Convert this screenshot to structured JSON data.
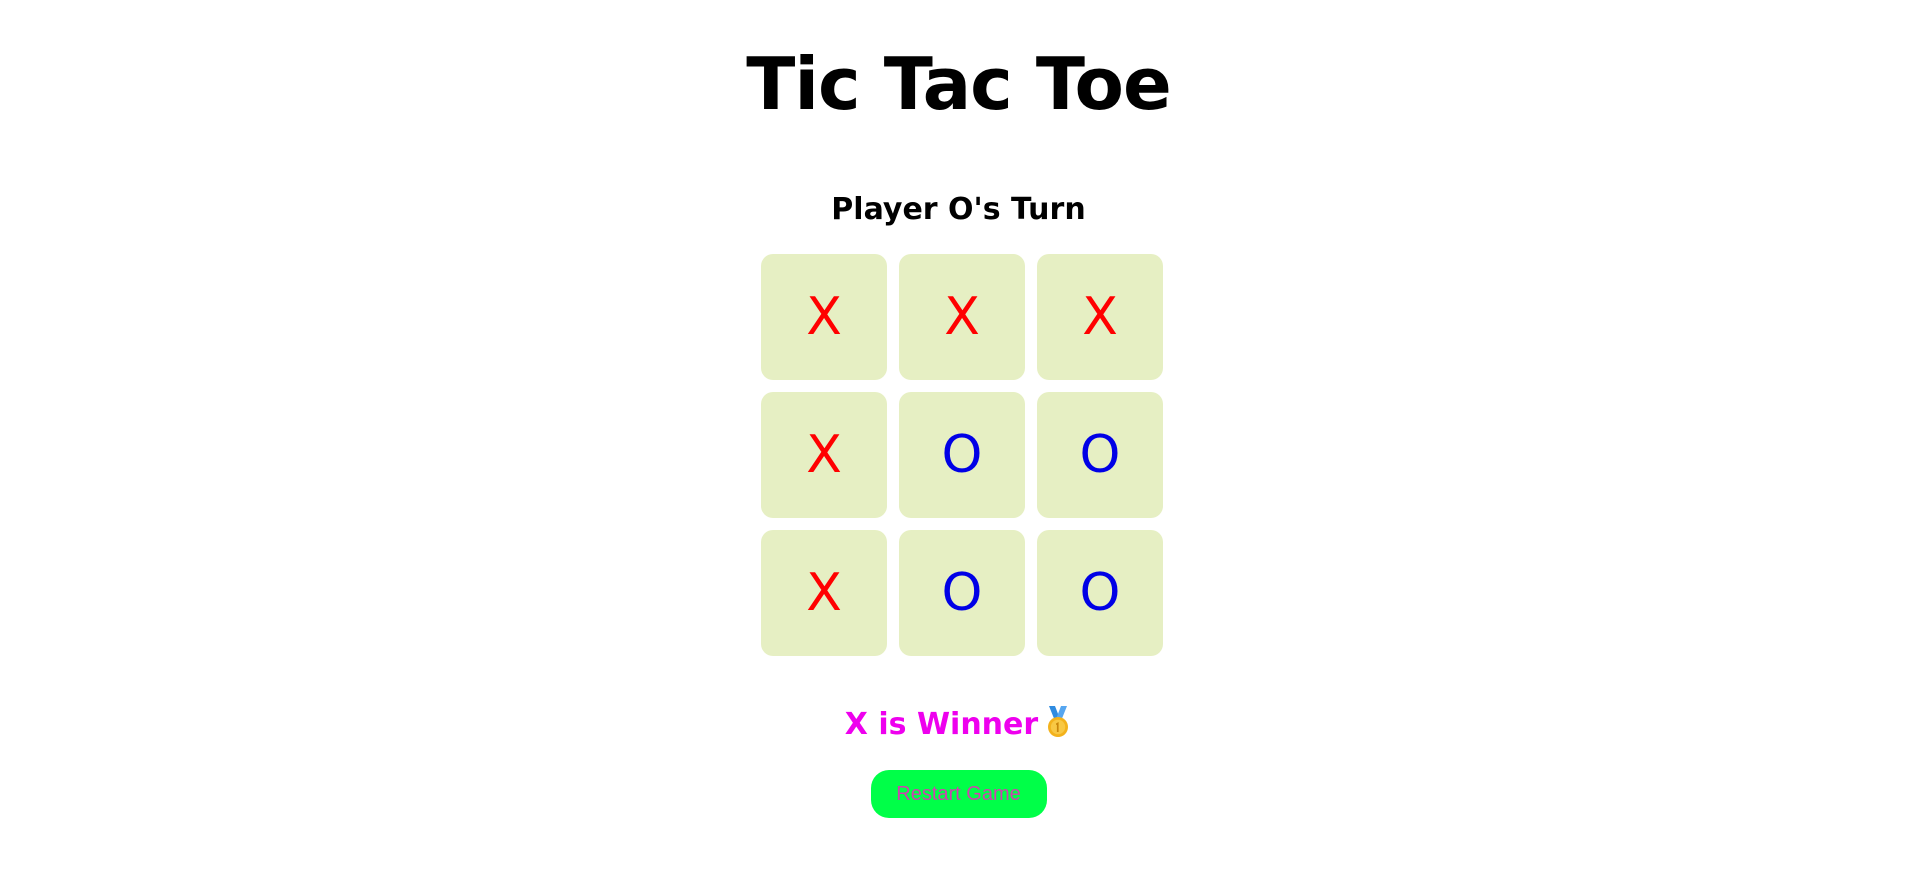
{
  "app": {
    "title": "Tic Tac Toe"
  },
  "status": {
    "turn_text": "Player O's Turn",
    "winner_text": "X is Winner",
    "winner_icon": "medal-icon"
  },
  "board": {
    "cells": [
      "X",
      "X",
      "X",
      "X",
      "O",
      "O",
      "X",
      "O",
      "O"
    ]
  },
  "controls": {
    "restart_label": "Restart Game"
  },
  "colors": {
    "x_color": "#ff0000",
    "o_color": "#0000e6",
    "cell_bg": "#e6efc3",
    "winner_color": "#ee00ee",
    "restart_bg": "#00ff48",
    "restart_text": "#d040b0"
  }
}
